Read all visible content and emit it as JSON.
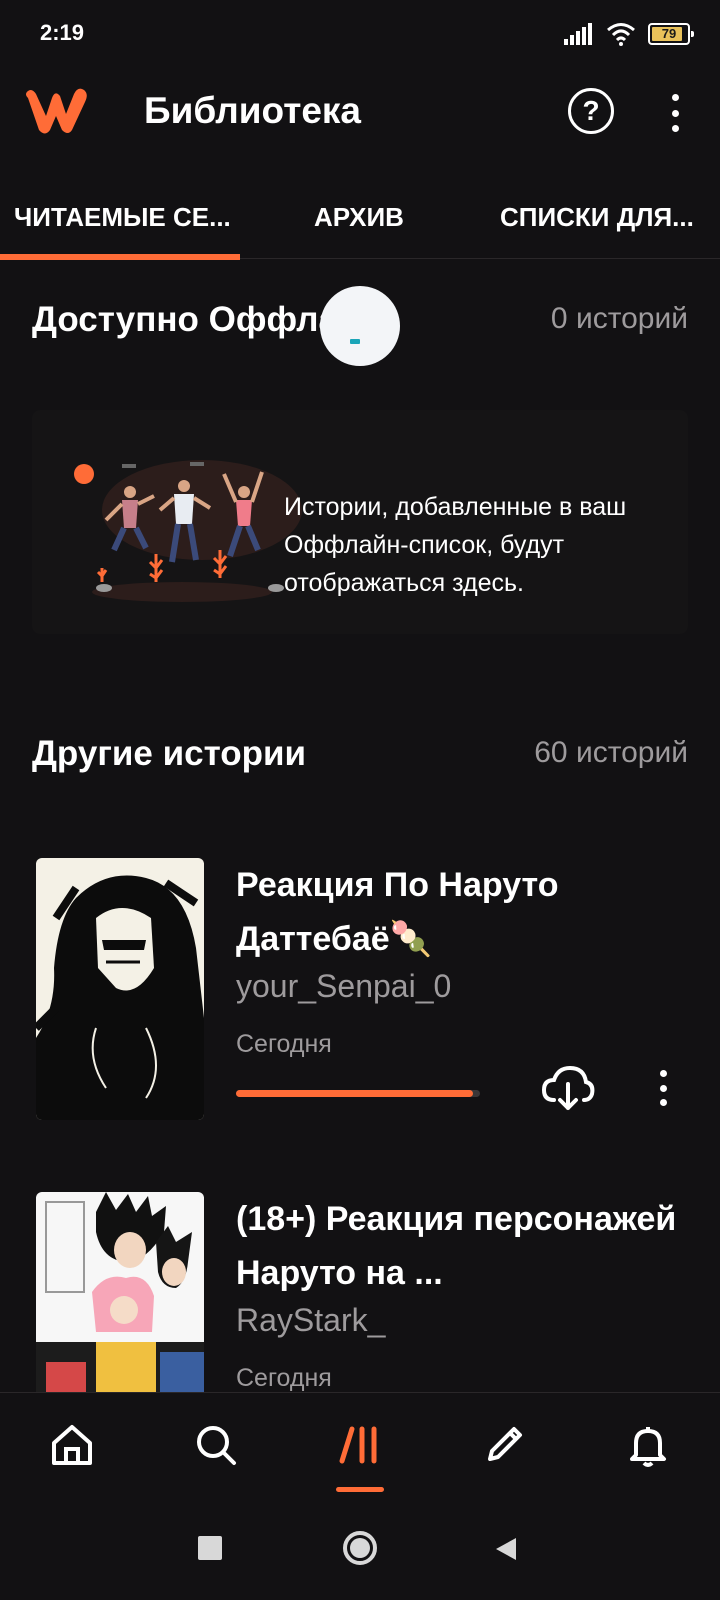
{
  "status_bar": {
    "time": "2:19",
    "battery_level": "79"
  },
  "app_bar": {
    "title": "Библиотека",
    "help_label": "?"
  },
  "tabs": [
    {
      "label": "ЧИТАЕМЫЕ СЕ...",
      "active": true
    },
    {
      "label": "АРХИВ",
      "active": false
    },
    {
      "label": "СПИСКИ ДЛЯ...",
      "active": false
    }
  ],
  "offline_section": {
    "title": "Доступно Оффла",
    "count": "0 историй",
    "empty_message": "Истории, добавленные в ваш Оффлайн-список, будут отображаться здесь."
  },
  "other_section": {
    "title": "Другие истории",
    "count": "60 историй"
  },
  "stories": [
    {
      "title": "Реакция По Наруто Даттебаё🍡",
      "author": "your_Senpai_0",
      "date": "Сегодня",
      "progress": 0.97
    },
    {
      "title": "(18+) Реакция персонажей Наруто на ...",
      "author": "RayStark_",
      "date": "Сегодня"
    }
  ],
  "bottom_nav": {
    "items": [
      "home-icon",
      "search-icon",
      "library-icon",
      "write-icon",
      "notifications-icon"
    ],
    "active": "library-icon"
  },
  "colors": {
    "accent": "#ff6c37",
    "background": "#121113",
    "muted_text": "#9e9b9d"
  }
}
